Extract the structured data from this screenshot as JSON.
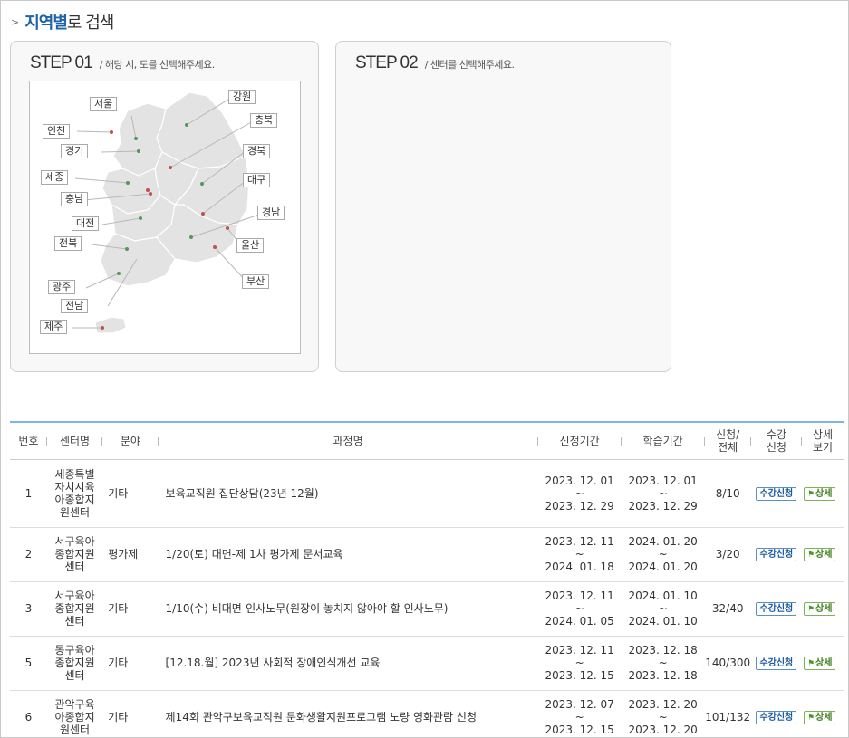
{
  "header": {
    "title_bold": "지역별",
    "title_rest": "로 검색",
    "bullet": ">"
  },
  "step1": {
    "label": "STEP 01",
    "desc": "/  해당 시, 도를 선택해주세요."
  },
  "step2": {
    "label": "STEP 02",
    "desc": "/  센터를 선택해주세요."
  },
  "map": {
    "regions": [
      {
        "key": "seoul",
        "label": "서울"
      },
      {
        "key": "gangwon",
        "label": "강원"
      },
      {
        "key": "incheon",
        "label": "인천"
      },
      {
        "key": "chungbuk",
        "label": "충북"
      },
      {
        "key": "gyeonggi",
        "label": "경기"
      },
      {
        "key": "gyeongbuk",
        "label": "경북"
      },
      {
        "key": "sejong",
        "label": "세종"
      },
      {
        "key": "daegu",
        "label": "대구"
      },
      {
        "key": "chungnam",
        "label": "충남"
      },
      {
        "key": "gyeongnam",
        "label": "경남"
      },
      {
        "key": "daejeon",
        "label": "대전"
      },
      {
        "key": "ulsan",
        "label": "울산"
      },
      {
        "key": "jeonbuk",
        "label": "전북"
      },
      {
        "key": "busan",
        "label": "부산"
      },
      {
        "key": "gwangju",
        "label": "광주"
      },
      {
        "key": "jeonnam",
        "label": "전남"
      },
      {
        "key": "jeju",
        "label": "제주"
      }
    ],
    "land_color": "#e3e3e3",
    "dot_red": "#c0504d",
    "dot_green": "#4f9a5a"
  },
  "table": {
    "headers": {
      "no": "번호",
      "center": "센터명",
      "field": "분야",
      "course": "과정명",
      "apply_period": "신청기간",
      "study_period": "학습기간",
      "count_l1": "신청/",
      "count_l2": "전체",
      "apply_l1": "수강",
      "apply_l2": "신청",
      "detail_l1": "상세",
      "detail_l2": "보기"
    },
    "tilde": "~",
    "apply_btn": "수강신청",
    "detail_btn": "상세",
    "rows": [
      {
        "no": "1",
        "center": "세종특별자치시육아종합지원센터",
        "field": "기타",
        "course": "보육교직원 집단상담(23년 12월)",
        "apply_from": "2023. 12. 01",
        "apply_to": "2023. 12. 29",
        "study_from": "2023. 12. 01",
        "study_to": "2023. 12. 29",
        "count": "8/10"
      },
      {
        "no": "2",
        "center": "서구육아종합지원센터",
        "field": "평가제",
        "course": "1/20(토) 대면-제 1차 평가제 문서교육",
        "apply_from": "2023. 12. 11",
        "apply_to": "2024. 01. 18",
        "study_from": "2024. 01. 20",
        "study_to": "2024. 01. 20",
        "count": "3/20"
      },
      {
        "no": "3",
        "center": "서구육아종합지원센터",
        "field": "기타",
        "course": "1/10(수) 비대면-인사노무(원장이 놓치지 않아야 할 인사노무)",
        "apply_from": "2023. 12. 11",
        "apply_to": "2024. 01. 05",
        "study_from": "2024. 01. 10",
        "study_to": "2024. 01. 10",
        "count": "32/40"
      },
      {
        "no": "5",
        "center": "동구육아종합지원센터",
        "field": "기타",
        "course": "[12.18.월] 2023년 사회적 장애인식개선 교육",
        "apply_from": "2023. 12. 11",
        "apply_to": "2023. 12. 15",
        "study_from": "2023. 12. 18",
        "study_to": "2023. 12. 18",
        "count": "140/300"
      },
      {
        "no": "6",
        "center": "관악구육아종합지원센터",
        "field": "기타",
        "course": "제14회 관악구보육교직원 문화생활지원프로그램 노량 영화관람 신청",
        "apply_from": "2023. 12. 07",
        "apply_to": "2023. 12. 15",
        "study_from": "2023. 12. 20",
        "study_to": "2023. 12. 20",
        "count": "101/132"
      }
    ]
  }
}
